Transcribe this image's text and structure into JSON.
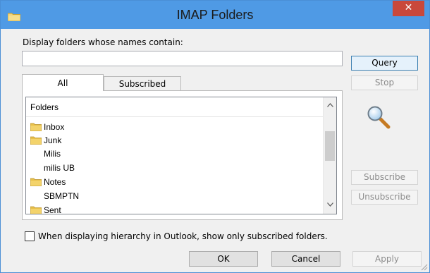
{
  "window": {
    "title": "IMAP Folders",
    "close_label": "✕"
  },
  "search": {
    "label": "Display folders whose names contain:",
    "value": "",
    "placeholder": ""
  },
  "buttons": {
    "query": "Query",
    "stop": "Stop",
    "subscribe": "Subscribe",
    "unsubscribe": "Unsubscribe",
    "ok": "OK",
    "cancel": "Cancel",
    "apply": "Apply"
  },
  "tabs": [
    {
      "label": "All",
      "active": true
    },
    {
      "label": "Subscribed",
      "active": false
    }
  ],
  "folder_list": {
    "header": "Folders",
    "items": [
      {
        "label": "Inbox",
        "icon": "folder-icon"
      },
      {
        "label": "Junk",
        "icon": "folder-icon"
      },
      {
        "label": "Milis",
        "icon": ""
      },
      {
        "label": "milis UB",
        "icon": ""
      },
      {
        "label": "Notes",
        "icon": "folder-icon"
      },
      {
        "label": "SBMPTN",
        "icon": ""
      },
      {
        "label": "Sent",
        "icon": "folder-icon"
      }
    ]
  },
  "hierarchy_option": {
    "label": "When displaying hierarchy in Outlook, show only subscribed folders.",
    "checked": false
  },
  "icons": {
    "title": "folder-icon",
    "search": "magnifier-icon",
    "scroll_up": "chevron-up-icon",
    "scroll_down": "chevron-down-icon"
  },
  "colors": {
    "title_bar": "#4f9ae5",
    "close_button": "#c9483b",
    "folder_yellow": "#e8c04a",
    "default_button_border": "#3c7fb1"
  }
}
